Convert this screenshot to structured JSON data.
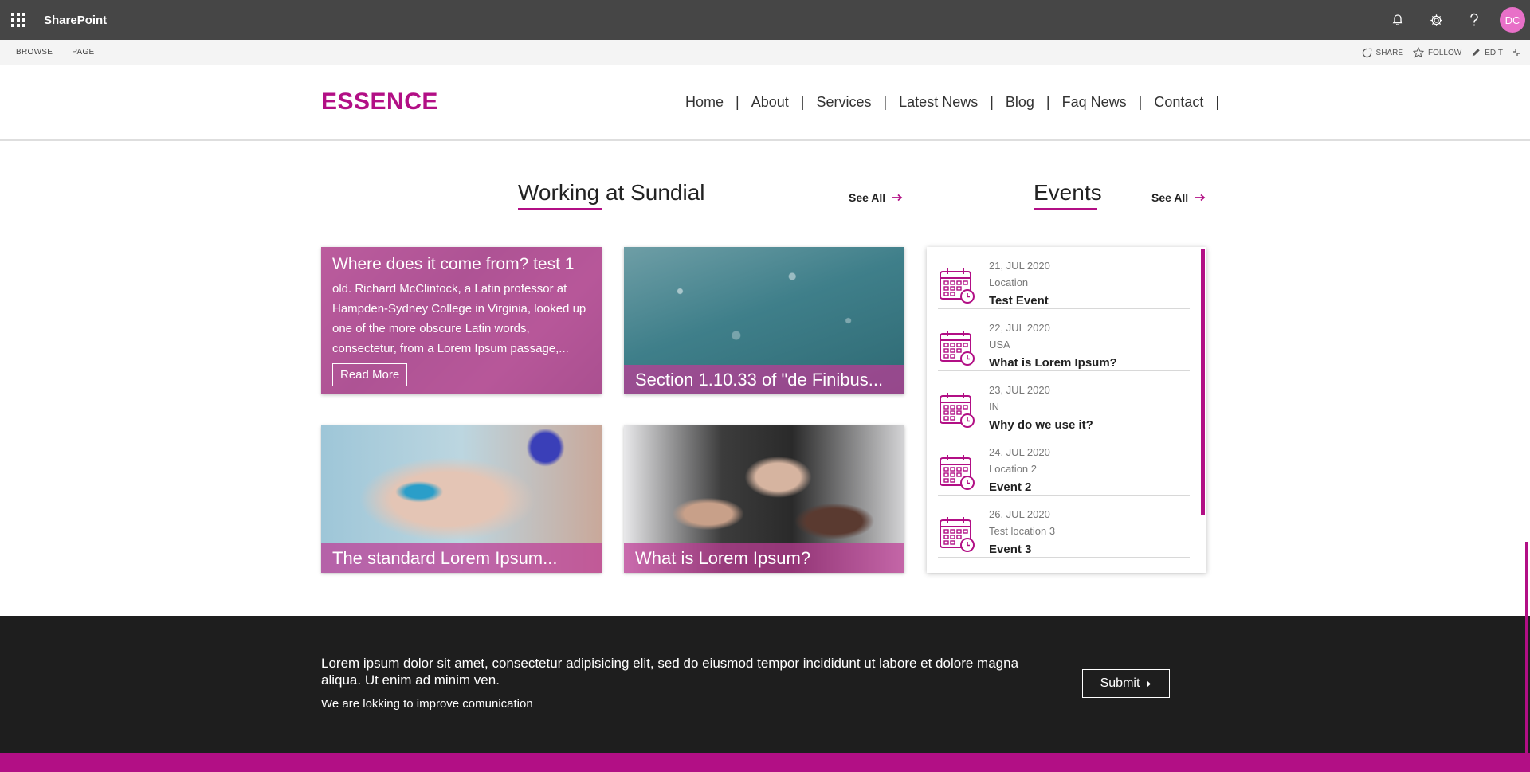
{
  "suite": {
    "app_name": "SharePoint",
    "avatar_initials": "DC",
    "avatar_color": "#e870c8",
    "icons": [
      "waffle-icon",
      "bell-icon",
      "gear-icon",
      "help-icon"
    ]
  },
  "ribbon": {
    "tabs": [
      "BROWSE",
      "PAGE"
    ],
    "actions": [
      {
        "label": "SHARE",
        "icon": "share-icon"
      },
      {
        "label": "FOLLOW",
        "icon": "star-icon"
      },
      {
        "label": "EDIT",
        "icon": "pencil-icon"
      }
    ]
  },
  "header": {
    "logo": "ESSENCE",
    "nav": [
      "Home",
      "About",
      "Services",
      "Latest News",
      "Blog",
      "Faq News",
      "Contact"
    ],
    "separator": "|"
  },
  "colors": {
    "accent": "#b20f85",
    "footer_bg": "#1e1e1e",
    "suitebar_bg": "#464646"
  },
  "working": {
    "title": "Working at Sundial",
    "see_all": "See All",
    "tiles": [
      {
        "title": "Where does it come from? test 1",
        "description": "old. Richard McClintock, a Latin professor at Hampden-Sydney College in Virginia, looked up one of the more obscure Latin words, consectetur, from a Lorem Ipsum passage,...",
        "button": "Read More"
      },
      {
        "title": "Section 1.10.33 of \"de Finibus..."
      },
      {
        "title": "The standard Lorem Ipsum..."
      },
      {
        "title": "What is Lorem Ipsum?"
      }
    ]
  },
  "events": {
    "title": "Events",
    "see_all": "See All",
    "items": [
      {
        "date": "21, JUL 2020",
        "location": "Location",
        "name": "Test Event"
      },
      {
        "date": "22, JUL 2020",
        "location": "USA",
        "name": "What is Lorem Ipsum?"
      },
      {
        "date": "23, JUL 2020",
        "location": "IN",
        "name": "Why do we use it?"
      },
      {
        "date": "24, JUL 2020",
        "location": "Location 2",
        "name": "Event 2"
      },
      {
        "date": "26, JUL 2020",
        "location": "Test location 3",
        "name": "Event 3"
      }
    ]
  },
  "footer": {
    "text": "Lorem ipsum dolor sit amet, consectetur adipisicing elit, sed do eiusmod tempor incididunt ut labore et dolore magna aliqua. Ut enim ad minim ven.",
    "subtext": "We are lokking to improve comunication",
    "submit": "Submit"
  }
}
